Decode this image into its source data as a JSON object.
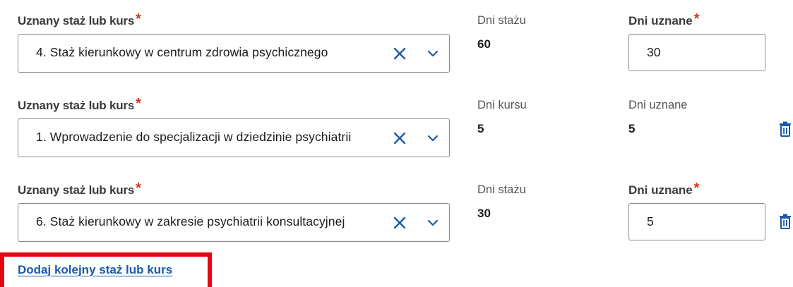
{
  "rows": [
    {
      "course_label": "Uznany staż lub kurs",
      "required_mark": "*",
      "selected_value": "4. Staż kierunkowy w centrum zdrowia psychicznego",
      "days_label": "Dni stażu",
      "days_value": "60",
      "recognized_label": "Dni uznane",
      "recognized_required_mark": "*",
      "recognized_value": "30",
      "recognized_editable": true
    },
    {
      "course_label": "Uznany staż lub kurs",
      "required_mark": "*",
      "selected_value": "1. Wprowadzenie do specjalizacji w dziedzinie psychiatrii",
      "days_label": "Dni kursu",
      "days_value": "5",
      "recognized_label": "Dni uznane",
      "recognized_value": "5",
      "recognized_editable": false
    },
    {
      "course_label": "Uznany staż lub kurs",
      "required_mark": "*",
      "selected_value": "6. Staż kierunkowy w zakresie psychiatrii konsultacyjnej",
      "days_label": "Dni stażu",
      "days_value": "30",
      "recognized_label": "Dni uznane",
      "recognized_required_mark": "*",
      "recognized_value": "5",
      "recognized_editable": true
    }
  ],
  "add_link_label": "Dodaj kolejny staż lub kurs",
  "icons": {
    "clear": "close-icon",
    "expand": "chevron-down-icon",
    "delete": "trash-icon"
  },
  "colors": {
    "required": "#d4351c",
    "icon": "#1a5aa8",
    "link": "#1a5aa8",
    "highlight": "#e30613"
  }
}
